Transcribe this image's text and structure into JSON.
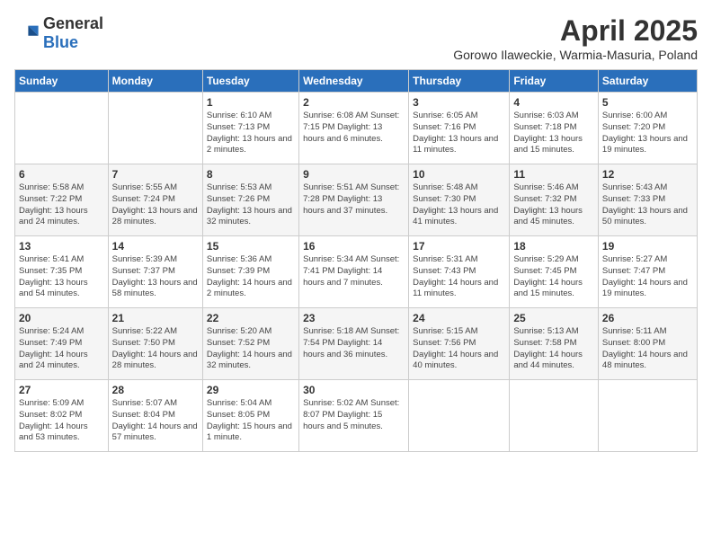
{
  "header": {
    "logo_general": "General",
    "logo_blue": "Blue",
    "title": "April 2025",
    "subtitle": "Gorowo Ilaweckie, Warmia-Masuria, Poland"
  },
  "columns": [
    "Sunday",
    "Monday",
    "Tuesday",
    "Wednesday",
    "Thursday",
    "Friday",
    "Saturday"
  ],
  "weeks": [
    [
      {
        "day": "",
        "info": ""
      },
      {
        "day": "",
        "info": ""
      },
      {
        "day": "1",
        "info": "Sunrise: 6:10 AM\nSunset: 7:13 PM\nDaylight: 13 hours and 2 minutes."
      },
      {
        "day": "2",
        "info": "Sunrise: 6:08 AM\nSunset: 7:15 PM\nDaylight: 13 hours and 6 minutes."
      },
      {
        "day": "3",
        "info": "Sunrise: 6:05 AM\nSunset: 7:16 PM\nDaylight: 13 hours and 11 minutes."
      },
      {
        "day": "4",
        "info": "Sunrise: 6:03 AM\nSunset: 7:18 PM\nDaylight: 13 hours and 15 minutes."
      },
      {
        "day": "5",
        "info": "Sunrise: 6:00 AM\nSunset: 7:20 PM\nDaylight: 13 hours and 19 minutes."
      }
    ],
    [
      {
        "day": "6",
        "info": "Sunrise: 5:58 AM\nSunset: 7:22 PM\nDaylight: 13 hours and 24 minutes."
      },
      {
        "day": "7",
        "info": "Sunrise: 5:55 AM\nSunset: 7:24 PM\nDaylight: 13 hours and 28 minutes."
      },
      {
        "day": "8",
        "info": "Sunrise: 5:53 AM\nSunset: 7:26 PM\nDaylight: 13 hours and 32 minutes."
      },
      {
        "day": "9",
        "info": "Sunrise: 5:51 AM\nSunset: 7:28 PM\nDaylight: 13 hours and 37 minutes."
      },
      {
        "day": "10",
        "info": "Sunrise: 5:48 AM\nSunset: 7:30 PM\nDaylight: 13 hours and 41 minutes."
      },
      {
        "day": "11",
        "info": "Sunrise: 5:46 AM\nSunset: 7:32 PM\nDaylight: 13 hours and 45 minutes."
      },
      {
        "day": "12",
        "info": "Sunrise: 5:43 AM\nSunset: 7:33 PM\nDaylight: 13 hours and 50 minutes."
      }
    ],
    [
      {
        "day": "13",
        "info": "Sunrise: 5:41 AM\nSunset: 7:35 PM\nDaylight: 13 hours and 54 minutes."
      },
      {
        "day": "14",
        "info": "Sunrise: 5:39 AM\nSunset: 7:37 PM\nDaylight: 13 hours and 58 minutes."
      },
      {
        "day": "15",
        "info": "Sunrise: 5:36 AM\nSunset: 7:39 PM\nDaylight: 14 hours and 2 minutes."
      },
      {
        "day": "16",
        "info": "Sunrise: 5:34 AM\nSunset: 7:41 PM\nDaylight: 14 hours and 7 minutes."
      },
      {
        "day": "17",
        "info": "Sunrise: 5:31 AM\nSunset: 7:43 PM\nDaylight: 14 hours and 11 minutes."
      },
      {
        "day": "18",
        "info": "Sunrise: 5:29 AM\nSunset: 7:45 PM\nDaylight: 14 hours and 15 minutes."
      },
      {
        "day": "19",
        "info": "Sunrise: 5:27 AM\nSunset: 7:47 PM\nDaylight: 14 hours and 19 minutes."
      }
    ],
    [
      {
        "day": "20",
        "info": "Sunrise: 5:24 AM\nSunset: 7:49 PM\nDaylight: 14 hours and 24 minutes."
      },
      {
        "day": "21",
        "info": "Sunrise: 5:22 AM\nSunset: 7:50 PM\nDaylight: 14 hours and 28 minutes."
      },
      {
        "day": "22",
        "info": "Sunrise: 5:20 AM\nSunset: 7:52 PM\nDaylight: 14 hours and 32 minutes."
      },
      {
        "day": "23",
        "info": "Sunrise: 5:18 AM\nSunset: 7:54 PM\nDaylight: 14 hours and 36 minutes."
      },
      {
        "day": "24",
        "info": "Sunrise: 5:15 AM\nSunset: 7:56 PM\nDaylight: 14 hours and 40 minutes."
      },
      {
        "day": "25",
        "info": "Sunrise: 5:13 AM\nSunset: 7:58 PM\nDaylight: 14 hours and 44 minutes."
      },
      {
        "day": "26",
        "info": "Sunrise: 5:11 AM\nSunset: 8:00 PM\nDaylight: 14 hours and 48 minutes."
      }
    ],
    [
      {
        "day": "27",
        "info": "Sunrise: 5:09 AM\nSunset: 8:02 PM\nDaylight: 14 hours and 53 minutes."
      },
      {
        "day": "28",
        "info": "Sunrise: 5:07 AM\nSunset: 8:04 PM\nDaylight: 14 hours and 57 minutes."
      },
      {
        "day": "29",
        "info": "Sunrise: 5:04 AM\nSunset: 8:05 PM\nDaylight: 15 hours and 1 minute."
      },
      {
        "day": "30",
        "info": "Sunrise: 5:02 AM\nSunset: 8:07 PM\nDaylight: 15 hours and 5 minutes."
      },
      {
        "day": "",
        "info": ""
      },
      {
        "day": "",
        "info": ""
      },
      {
        "day": "",
        "info": ""
      }
    ]
  ]
}
